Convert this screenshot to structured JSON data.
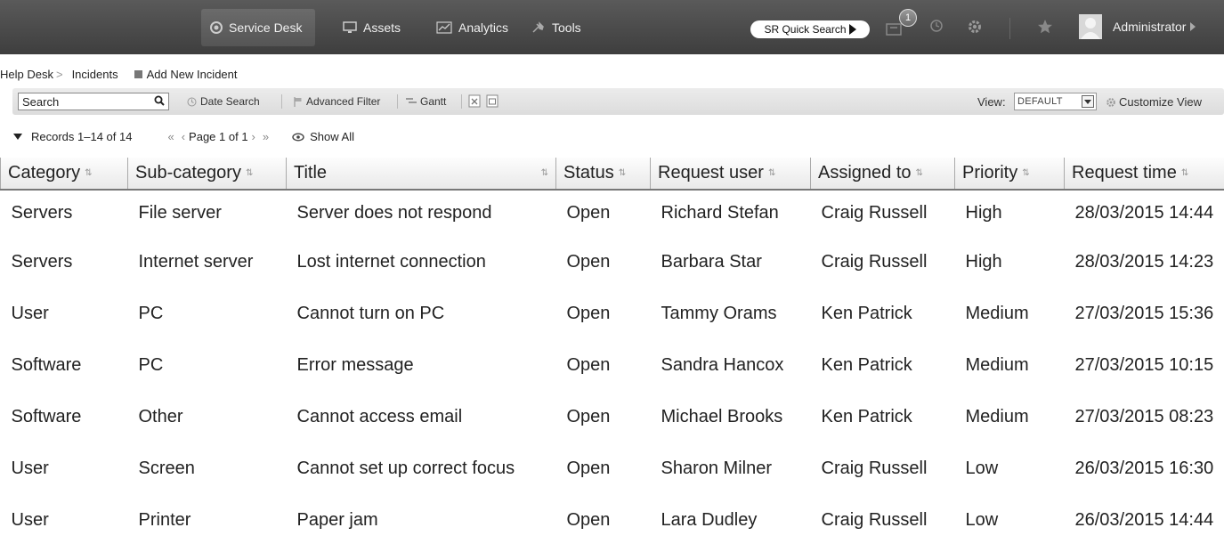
{
  "nav": {
    "items": [
      {
        "label": "Service Desk",
        "icon": "service-desk-icon"
      },
      {
        "label": "Assets",
        "icon": "monitor-icon"
      },
      {
        "label": "Analytics",
        "icon": "analytics-icon"
      },
      {
        "label": "Tools",
        "icon": "tools-icon"
      }
    ],
    "active": "Service Desk",
    "sr_search": "SR Quick Search",
    "notification_count": "1",
    "user": "Administrator"
  },
  "breadcrumb": {
    "root": "Help Desk",
    "sep": ">",
    "current": "Incidents",
    "add_label": "Add New Incident"
  },
  "toolbar": {
    "search_value": "Search",
    "date_search": "Date Search",
    "advanced_filter": "Advanced Filter",
    "gantt": "Gantt",
    "view_label": "View:",
    "view_value": "DEFAULT",
    "customize": "Customize View"
  },
  "records": {
    "range": "Records 1–14 of 14",
    "page": "Page 1 of 1",
    "show_all": "Show All"
  },
  "table": {
    "columns": [
      "Category",
      "Sub-category",
      "Title",
      "Status",
      "Request user",
      "Assigned to",
      "Priority",
      "Request time"
    ],
    "rows": [
      [
        "Servers",
        "File server",
        "Server does not respond",
        "Open",
        "Richard Stefan",
        "Craig Russell",
        "High",
        "28/03/2015 14:44"
      ],
      [
        "Servers",
        "Internet server",
        "Lost internet connection",
        "Open",
        "Barbara Star",
        "Craig Russell",
        "High",
        "28/03/2015 14:23"
      ],
      [
        "User",
        "PC",
        "Cannot turn on PC",
        "Open",
        "Tammy Orams",
        "Ken Patrick",
        "Medium",
        "27/03/2015 15:36"
      ],
      [
        "Software",
        "PC",
        "Error message",
        "Open",
        "Sandra Hancox",
        "Ken Patrick",
        "Medium",
        "27/03/2015 10:15"
      ],
      [
        "Software",
        "Other",
        "Cannot access email",
        "Open",
        "Michael Brooks",
        "Ken Patrick",
        "Medium",
        "27/03/2015 08:23"
      ],
      [
        "User",
        "Screen",
        "Cannot set up correct focus",
        "Open",
        "Sharon Milner",
        "Craig Russell",
        "Low",
        "26/03/2015 16:30"
      ],
      [
        "User",
        "Printer",
        "Paper jam",
        "Open",
        "Lara Dudley",
        "Craig Russell",
        "Low",
        "26/03/2015 14:44"
      ]
    ]
  }
}
